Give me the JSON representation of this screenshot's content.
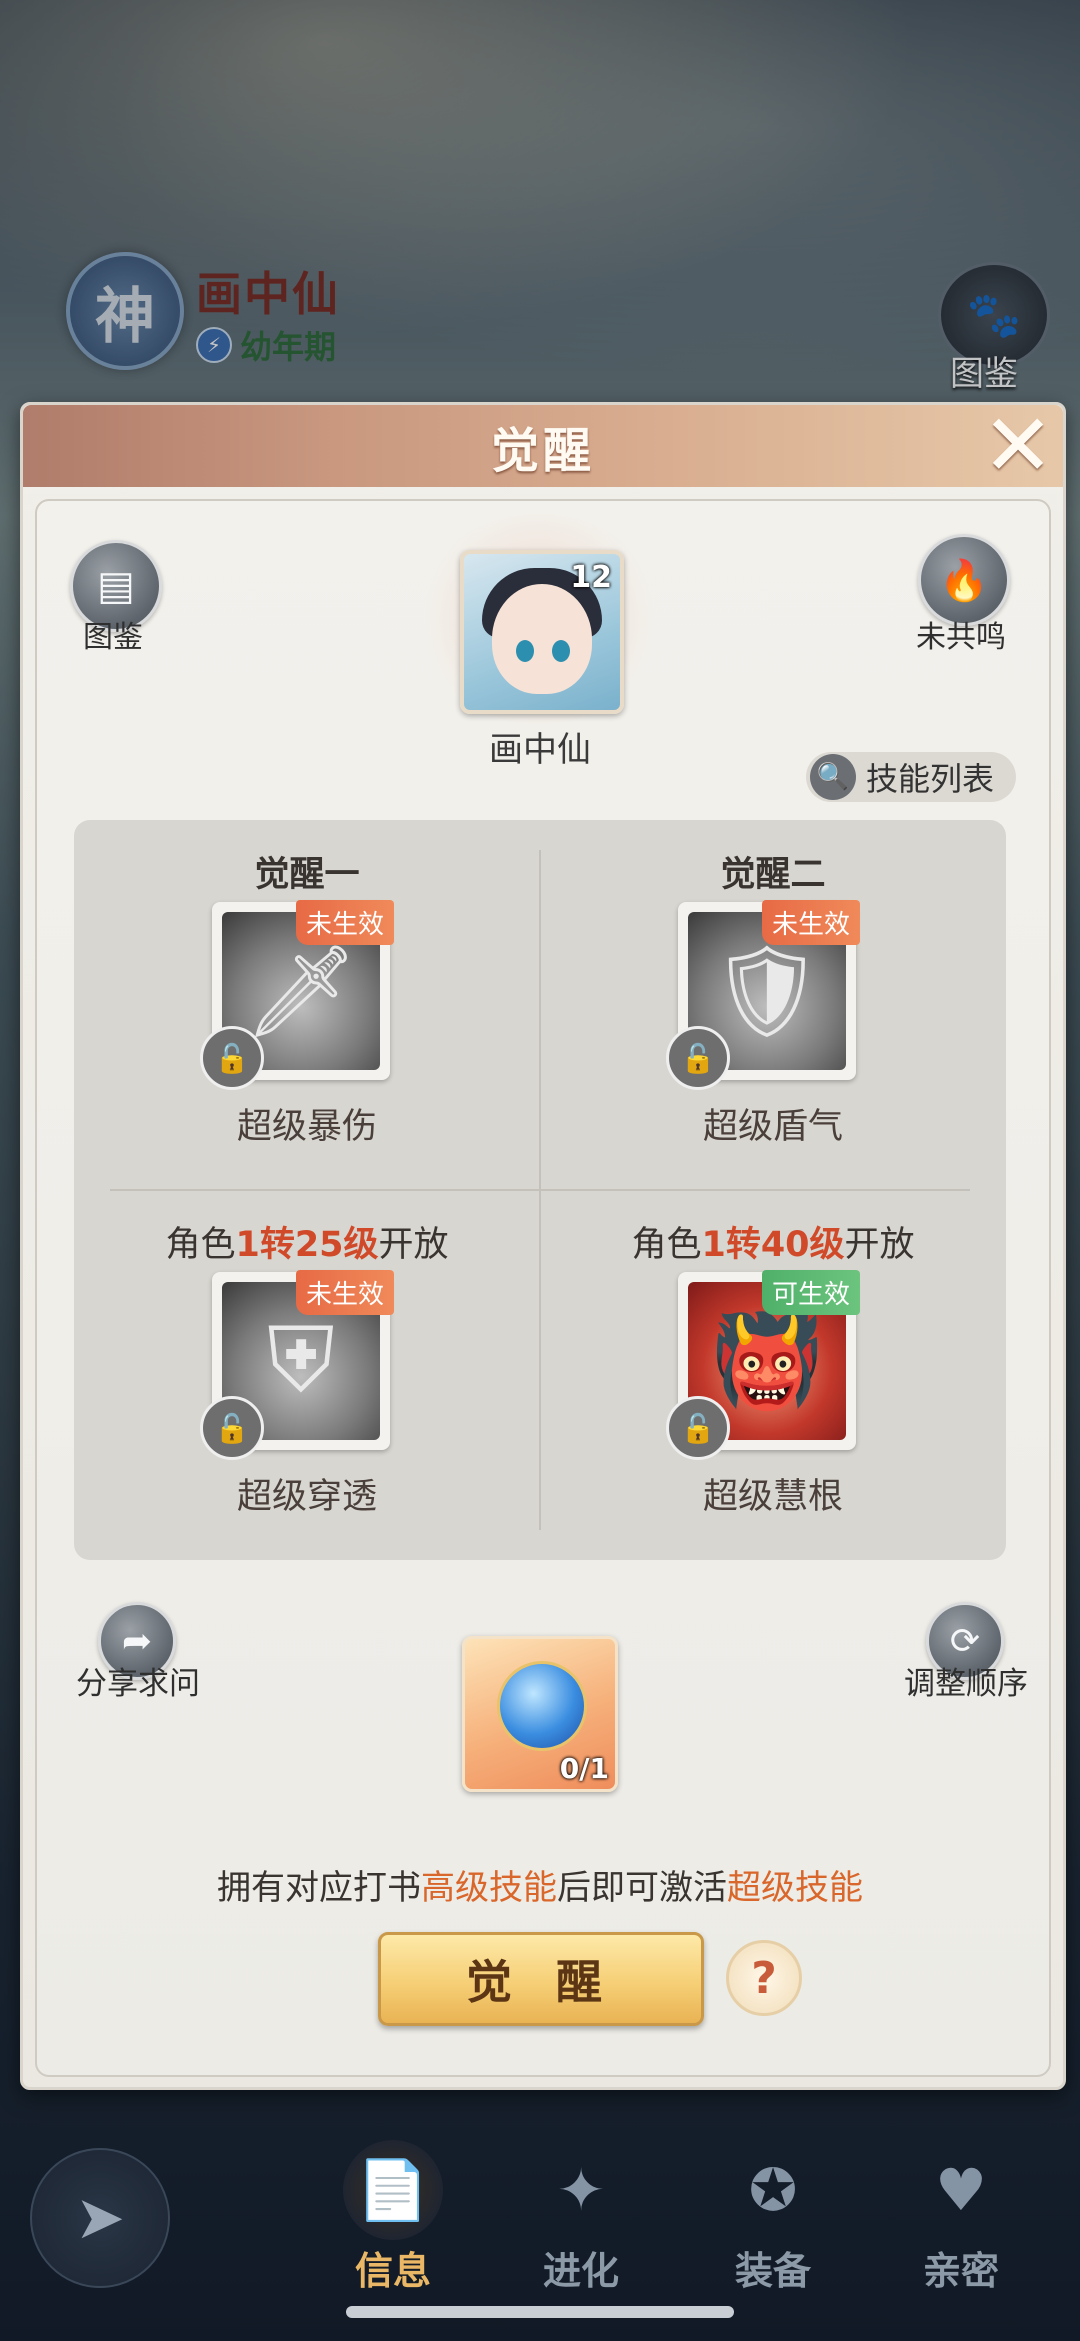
{
  "background": {
    "god_badge_char": "神",
    "hero_name": "画中仙",
    "stage": "幼年期",
    "codex_label": "图鉴"
  },
  "modal": {
    "title": "觉醒",
    "close_icon": "close-icon",
    "codex_label": "图鉴",
    "resonance_label": "未共鸣",
    "hero": {
      "name": "画中仙",
      "level": "12"
    },
    "skill_list_label": "技能列表",
    "slots": [
      {
        "header": "觉醒一",
        "header_prefix": "",
        "header_highlight": "",
        "header_suffix": "",
        "skill": "超级暴伤",
        "status": "未生效",
        "status_color": "#e76a45",
        "locked": true
      },
      {
        "header": "觉醒二",
        "header_prefix": "",
        "header_highlight": "",
        "header_suffix": "",
        "skill": "超级盾气",
        "status": "未生效",
        "status_color": "#e76a45",
        "locked": true
      },
      {
        "header": "",
        "header_prefix": "角色",
        "header_highlight": "1转25级",
        "header_suffix": "开放",
        "skill": "超级穿透",
        "status": "未生效",
        "status_color": "#e76a45",
        "locked": true
      },
      {
        "header": "",
        "header_prefix": "角色",
        "header_highlight": "1转40级",
        "header_suffix": "开放",
        "skill": "超级慧根",
        "status": "可生效",
        "status_color": "#4fb06a",
        "locked": true
      }
    ],
    "share_label": "分享求问",
    "reorder_label": "调整顺序",
    "material": {
      "count": "0/1"
    },
    "hint": {
      "part1": "拥有对应打书",
      "highlight1": "高级技能",
      "part2": "后即可激活",
      "highlight2": "超级技能"
    },
    "awaken_button": "觉 醒",
    "help_symbol": "?"
  },
  "nav": {
    "items": [
      {
        "label": "信息",
        "active": true,
        "icon": "info-icon"
      },
      {
        "label": "进化",
        "active": false,
        "icon": "evolve-icon"
      },
      {
        "label": "装备",
        "active": false,
        "icon": "equipment-icon"
      },
      {
        "label": "亲密",
        "active": false,
        "icon": "intimacy-icon"
      }
    ]
  }
}
